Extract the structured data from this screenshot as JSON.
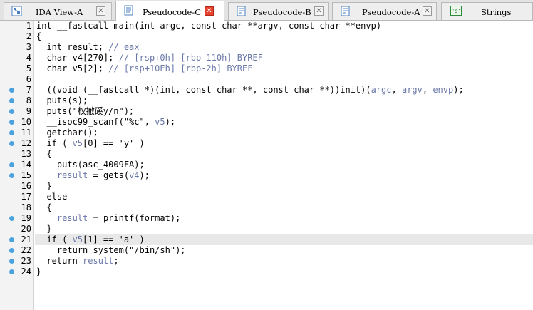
{
  "tabs": [
    {
      "label": "IDA View-A",
      "icon": "graph-view-icon",
      "active": false
    },
    {
      "label": "Pseudocode-C",
      "icon": "pseudocode-icon",
      "active": true
    },
    {
      "label": "Pseudocode-B",
      "icon": "pseudocode-icon",
      "active": false
    },
    {
      "label": "Pseudocode-A",
      "icon": "pseudocode-icon",
      "active": false
    },
    {
      "label": "Strings",
      "icon": "strings-icon",
      "active": false
    }
  ],
  "close_glyph": "✕",
  "strings_icon_text": "\"s\"",
  "editor": {
    "highlight_line": 21,
    "lines": [
      {
        "num": 1,
        "dot": false,
        "parts": [
          [
            "t",
            "int __fastcall main(int argc, const char **argv, const char **envp)"
          ]
        ]
      },
      {
        "num": 2,
        "dot": false,
        "parts": [
          [
            "t",
            "{"
          ]
        ]
      },
      {
        "num": 3,
        "dot": false,
        "parts": [
          [
            "t",
            "  int result; "
          ],
          [
            "c",
            "// eax"
          ]
        ]
      },
      {
        "num": 4,
        "dot": false,
        "parts": [
          [
            "t",
            "  char v4[270]; "
          ],
          [
            "c",
            "// [rsp+0h] [rbp-110h] BYREF"
          ]
        ]
      },
      {
        "num": 5,
        "dot": false,
        "parts": [
          [
            "t",
            "  char v5[2]; "
          ],
          [
            "c",
            "// [rsp+10Eh] [rbp-2h] BYREF"
          ]
        ]
      },
      {
        "num": 6,
        "dot": false,
        "parts": [
          [
            "t",
            ""
          ]
        ]
      },
      {
        "num": 7,
        "dot": true,
        "parts": [
          [
            "t",
            "  ((void (__fastcall *)(int, const char **, const char **))init)("
          ],
          [
            "v",
            "argc"
          ],
          [
            "t",
            ", "
          ],
          [
            "v",
            "argv"
          ],
          [
            "t",
            ", "
          ],
          [
            "v",
            "envp"
          ],
          [
            "t",
            ");"
          ]
        ]
      },
      {
        "num": 8,
        "dot": true,
        "parts": [
          [
            "t",
            "  puts(s);"
          ]
        ]
      },
      {
        "num": 9,
        "dot": true,
        "parts": [
          [
            "t",
            "  puts(\"权撤磎y/n\");"
          ]
        ]
      },
      {
        "num": 10,
        "dot": true,
        "parts": [
          [
            "t",
            "  __isoc99_scanf(\"%c\", "
          ],
          [
            "v",
            "v5"
          ],
          [
            "t",
            ");"
          ]
        ]
      },
      {
        "num": 11,
        "dot": true,
        "parts": [
          [
            "t",
            "  getchar();"
          ]
        ]
      },
      {
        "num": 12,
        "dot": true,
        "parts": [
          [
            "t",
            "  if ( "
          ],
          [
            "v",
            "v5"
          ],
          [
            "t",
            "[0] == 'y' )"
          ]
        ]
      },
      {
        "num": 13,
        "dot": false,
        "parts": [
          [
            "t",
            "  {"
          ]
        ]
      },
      {
        "num": 14,
        "dot": true,
        "parts": [
          [
            "t",
            "    puts(asc_4009FA);"
          ]
        ]
      },
      {
        "num": 15,
        "dot": true,
        "parts": [
          [
            "t",
            "    "
          ],
          [
            "v",
            "result"
          ],
          [
            "t",
            " = gets("
          ],
          [
            "v",
            "v4"
          ],
          [
            "t",
            ");"
          ]
        ]
      },
      {
        "num": 16,
        "dot": false,
        "parts": [
          [
            "t",
            "  }"
          ]
        ]
      },
      {
        "num": 17,
        "dot": false,
        "parts": [
          [
            "t",
            "  else"
          ]
        ]
      },
      {
        "num": 18,
        "dot": false,
        "parts": [
          [
            "t",
            "  {"
          ]
        ]
      },
      {
        "num": 19,
        "dot": true,
        "parts": [
          [
            "t",
            "    "
          ],
          [
            "v",
            "result"
          ],
          [
            "t",
            " = printf(format);"
          ]
        ]
      },
      {
        "num": 20,
        "dot": false,
        "parts": [
          [
            "t",
            "  }"
          ]
        ]
      },
      {
        "num": 21,
        "dot": true,
        "parts": [
          [
            "t",
            "  if ( "
          ],
          [
            "v",
            "v5"
          ],
          [
            "t",
            "[1] == 'a' )"
          ]
        ]
      },
      {
        "num": 22,
        "dot": true,
        "parts": [
          [
            "t",
            "    return system(\"/bin/sh\");"
          ]
        ]
      },
      {
        "num": 23,
        "dot": true,
        "parts": [
          [
            "t",
            "  return "
          ],
          [
            "v",
            "result"
          ],
          [
            "t",
            ";"
          ]
        ]
      },
      {
        "num": 24,
        "dot": true,
        "parts": [
          [
            "t",
            "}"
          ]
        ]
      }
    ]
  },
  "colors": {
    "breakpoint_dot": "#4aa3df",
    "variable": "#6b79a8",
    "comment": "#6b79a8",
    "active_close": "#e8422f"
  }
}
